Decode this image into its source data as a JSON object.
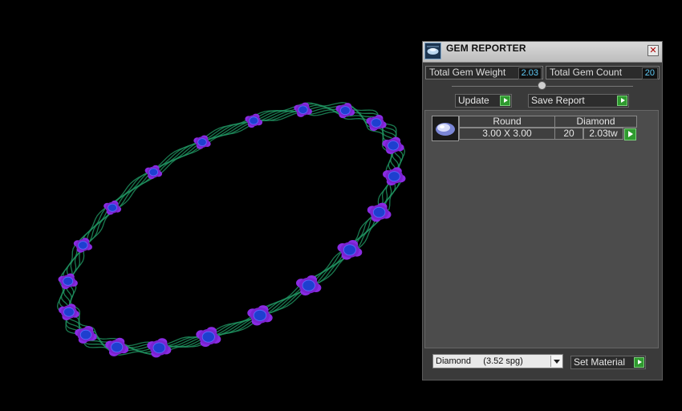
{
  "panel": {
    "title": "GEM REPORTER",
    "close_label": "✕",
    "total_weight_label": "Total Gem Weight",
    "total_weight_value": "2.03",
    "total_count_label": "Total Gem Count",
    "total_count_value": "20",
    "update_label": "Update",
    "save_report_label": "Save Report",
    "gem_row": {
      "shape": "Round",
      "material": "Diamond",
      "size": "3.00 X 3.00",
      "count": "20",
      "weight": "2.03tw"
    },
    "material_select": {
      "selected": "Diamond     (3.52 spg)"
    },
    "set_material_label": "Set Material"
  },
  "colors": {
    "background": "#000000",
    "band": "#1f8f5e",
    "setting": "#8a2be2",
    "gem": "#1e3fcf",
    "value_text": "#5ec9f5",
    "play_green": "#2e9a2e"
  }
}
